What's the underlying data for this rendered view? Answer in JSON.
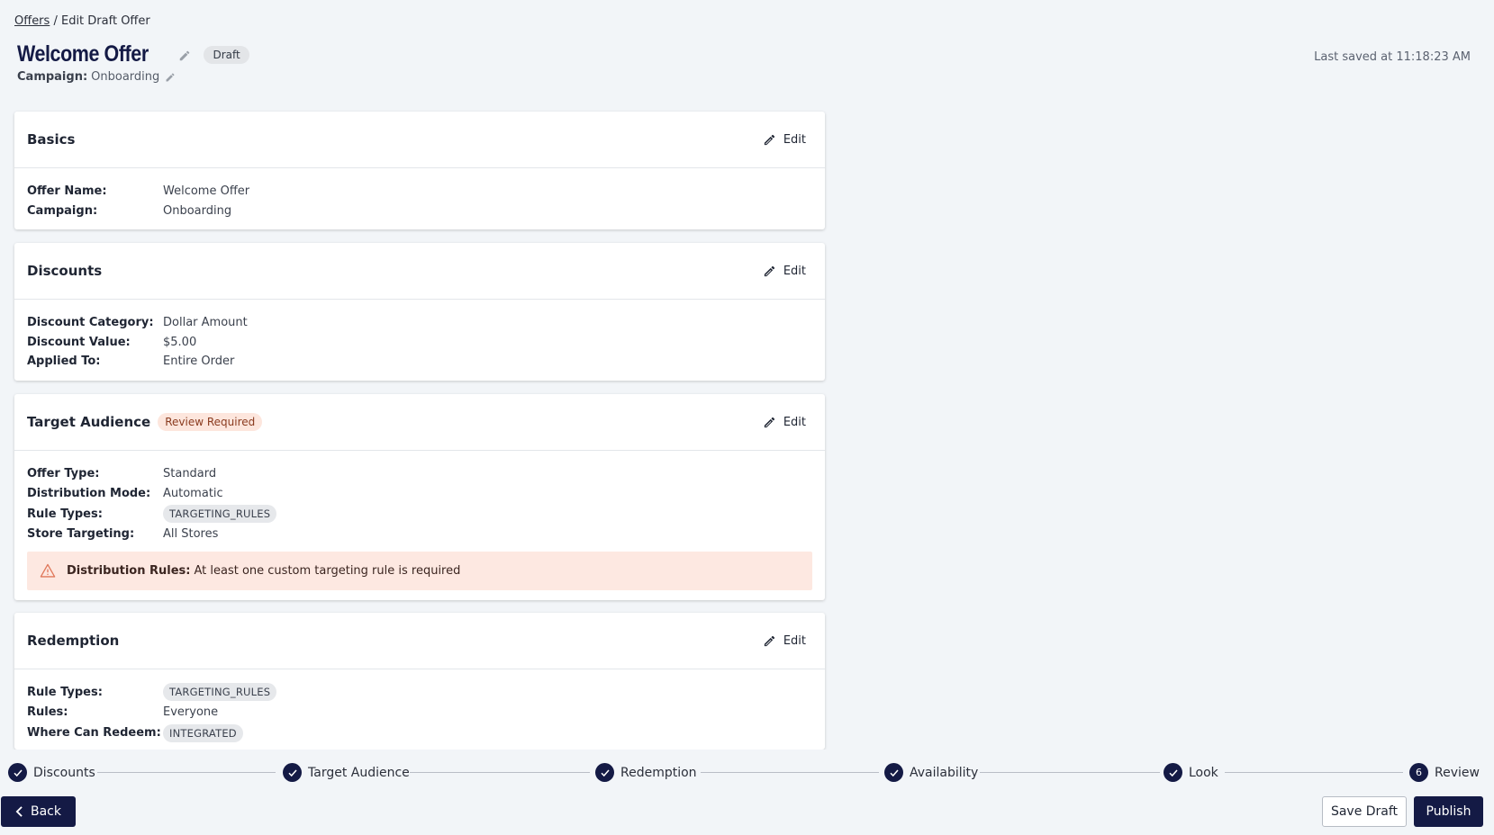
{
  "breadcrumb": {
    "link": "Offers",
    "separator": "/",
    "current": "Edit Draft Offer"
  },
  "header": {
    "title": "Welcome Offer",
    "status_badge": "Draft",
    "campaign_label": "Campaign:",
    "campaign_value": "Onboarding",
    "last_saved": "Last saved at 11:18:23 AM"
  },
  "edit_label": "Edit",
  "basics": {
    "title": "Basics",
    "fields": [
      {
        "label": "Offer Name:",
        "value": "Welcome Offer"
      },
      {
        "label": "Campaign:",
        "value": "Onboarding"
      }
    ]
  },
  "discounts": {
    "title": "Discounts",
    "fields": [
      {
        "label": "Discount Category:",
        "value": "Dollar Amount"
      },
      {
        "label": "Discount Value:",
        "value": "$5.00"
      },
      {
        "label": "Applied To:",
        "value": "Entire Order"
      }
    ]
  },
  "target_audience": {
    "title": "Target Audience",
    "badge": "Review Required",
    "fields": [
      {
        "label": "Offer Type:",
        "value": "Standard"
      },
      {
        "label": "Distribution Mode:",
        "value": "Automatic"
      },
      {
        "label": "Rule Types:",
        "value": "TARGETING_RULES"
      },
      {
        "label": "Store Targeting:",
        "value": "All Stores"
      }
    ],
    "alert_label": "Distribution Rules:",
    "alert_text": "At least one custom targeting rule is required"
  },
  "redemption": {
    "title": "Redemption",
    "fields": [
      {
        "label": "Rule Types:",
        "value": "TARGETING_RULES"
      },
      {
        "label": "Rules:",
        "value": "Everyone"
      },
      {
        "label": "Where Can Redeem:",
        "value": "INTEGRATED"
      }
    ]
  },
  "stepper": {
    "steps": [
      {
        "label": "Discounts",
        "state": "complete"
      },
      {
        "label": "Target Audience",
        "state": "complete"
      },
      {
        "label": "Redemption",
        "state": "complete"
      },
      {
        "label": "Availability",
        "state": "complete"
      },
      {
        "label": "Look",
        "state": "complete"
      },
      {
        "label": "Review",
        "number": "6",
        "state": "current"
      }
    ]
  },
  "footer": {
    "back_label": "Back",
    "save_label": "Save Draft",
    "publish_label": "Publish"
  },
  "colors": {
    "primary": "#141a45",
    "background": "#f2f5f8",
    "alert_bg": "#fde8e1",
    "warning_icon": "#e0775a"
  },
  "icons": [
    "pencil-icon",
    "warning-triangle-icon",
    "check-icon",
    "chevron-left-icon"
  ]
}
